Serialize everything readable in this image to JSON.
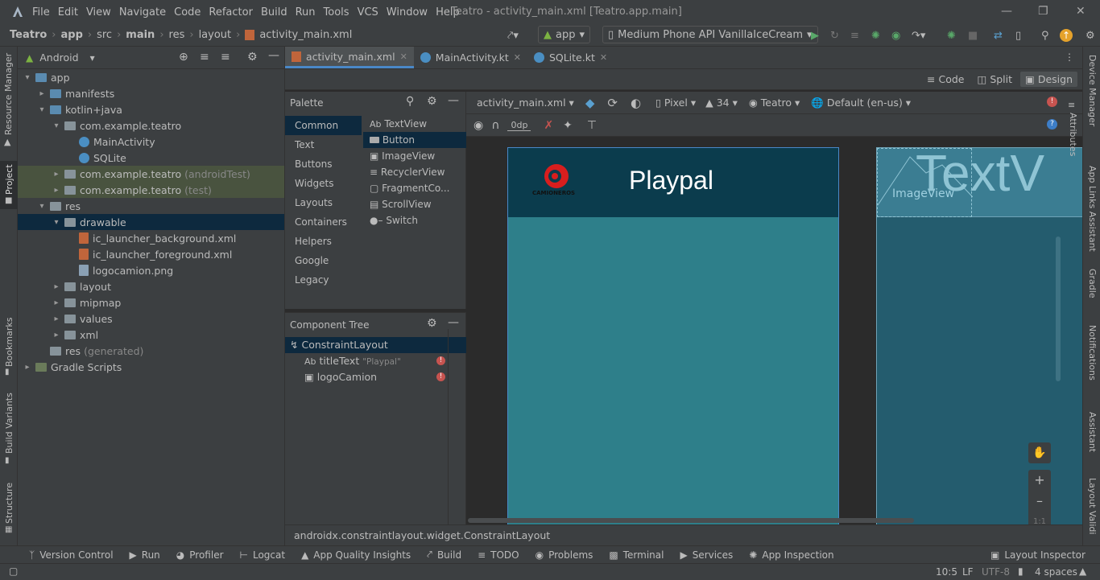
{
  "menubar": {
    "items": [
      "File",
      "Edit",
      "View",
      "Navigate",
      "Code",
      "Refactor",
      "Build",
      "Run",
      "Tools",
      "VCS",
      "Window",
      "Help"
    ],
    "window_title": "Teatro - activity_main.xml [Teatro.app.main]"
  },
  "navbar": {
    "breadcrumbs": [
      "Teatro",
      "app",
      "src",
      "main",
      "res",
      "layout",
      "activity_main.xml"
    ],
    "run_config": "app",
    "device": "Medium Phone API VanillaIceCream"
  },
  "left_strip": [
    "Resource Manager",
    "Project",
    "Bookmarks",
    "Build Variants",
    "Structure"
  ],
  "right_strip": [
    "Device Manager",
    "App Links Assistant",
    "Gradle",
    "Notifications",
    "Assistant",
    "Layout Validi"
  ],
  "project": {
    "view": "Android",
    "tree": [
      {
        "label": "app",
        "indent": 0,
        "expanded": true,
        "kind": "folder-blue"
      },
      {
        "label": "manifests",
        "indent": 1,
        "expanded": false,
        "kind": "folder-blue"
      },
      {
        "label": "kotlin+java",
        "indent": 1,
        "expanded": true,
        "kind": "folder-blue"
      },
      {
        "label": "com.example.teatro",
        "indent": 2,
        "expanded": true,
        "kind": "folder"
      },
      {
        "label": "MainActivity",
        "indent": 3,
        "kind": "kt"
      },
      {
        "label": "SQLite",
        "indent": 3,
        "kind": "kt"
      },
      {
        "label": "com.example.teatro",
        "suffix": "(androidTest)",
        "indent": 2,
        "expanded": false,
        "kind": "folder",
        "style": "test"
      },
      {
        "label": "com.example.teatro",
        "suffix": "(test)",
        "indent": 2,
        "expanded": false,
        "kind": "folder",
        "style": "test"
      },
      {
        "label": "res",
        "indent": 1,
        "expanded": true,
        "kind": "folder"
      },
      {
        "label": "drawable",
        "indent": 2,
        "expanded": true,
        "kind": "folder",
        "style": "sel"
      },
      {
        "label": "ic_launcher_background.xml",
        "indent": 3,
        "kind": "xml"
      },
      {
        "label": "ic_launcher_foreground.xml",
        "indent": 3,
        "kind": "xml"
      },
      {
        "label": "logocamion.png",
        "indent": 3,
        "kind": "png"
      },
      {
        "label": "layout",
        "indent": 2,
        "expanded": false,
        "kind": "folder"
      },
      {
        "label": "mipmap",
        "indent": 2,
        "expanded": false,
        "kind": "folder"
      },
      {
        "label": "values",
        "indent": 2,
        "expanded": false,
        "kind": "folder"
      },
      {
        "label": "xml",
        "indent": 2,
        "expanded": false,
        "kind": "folder"
      },
      {
        "label": "res",
        "suffix": "(generated)",
        "indent": 1,
        "kind": "folder"
      },
      {
        "label": "Gradle Scripts",
        "indent": 0,
        "expanded": false,
        "kind": "gradle"
      }
    ]
  },
  "tabs": [
    {
      "label": "activity_main.xml",
      "active": true
    },
    {
      "label": "MainActivity.kt",
      "active": false
    },
    {
      "label": "SQLite.kt",
      "active": false
    }
  ],
  "view_modes": [
    "Code",
    "Split",
    "Design"
  ],
  "palette": {
    "title": "Palette",
    "categories": [
      "Common",
      "Text",
      "Buttons",
      "Widgets",
      "Layouts",
      "Containers",
      "Helpers",
      "Google",
      "Legacy"
    ],
    "items": [
      "TextView",
      "Button",
      "ImageView",
      "RecyclerView",
      "FragmentCo...",
      "ScrollView",
      "Switch"
    ]
  },
  "component_tree": {
    "title": "Component Tree",
    "root": "ConstraintLayout",
    "children": [
      {
        "label": "titleText",
        "hint": "\"Playpal\""
      },
      {
        "label": "logoCamion",
        "hint": ""
      }
    ]
  },
  "design_toolbar": {
    "file": "activity_main.xml",
    "device": "Pixel",
    "api": "34",
    "theme": "Teatro",
    "locale": "Default (en-us)",
    "margin": "0dp"
  },
  "preview": {
    "title": "Playpal",
    "logo_caption": "CAMIONEROS",
    "blueprint_label": "ImageView",
    "blueprint_text": "TextV",
    "header_color": "#0b3c4d",
    "body_color": "#2e7f8a"
  },
  "zoom": {
    "one_to_one": "1:1"
  },
  "status_path": "androidx.constraintlayout.widget.ConstraintLayout",
  "bottom_tools": [
    "Version Control",
    "Run",
    "Profiler",
    "Logcat",
    "App Quality Insights",
    "Build",
    "TODO",
    "Problems",
    "Terminal",
    "Services",
    "App Inspection"
  ],
  "layout_inspector": "Layout Inspector",
  "statusbar": {
    "position": "10:5",
    "line_sep": "LF",
    "encoding": "UTF-8",
    "indent": "4 spaces"
  }
}
